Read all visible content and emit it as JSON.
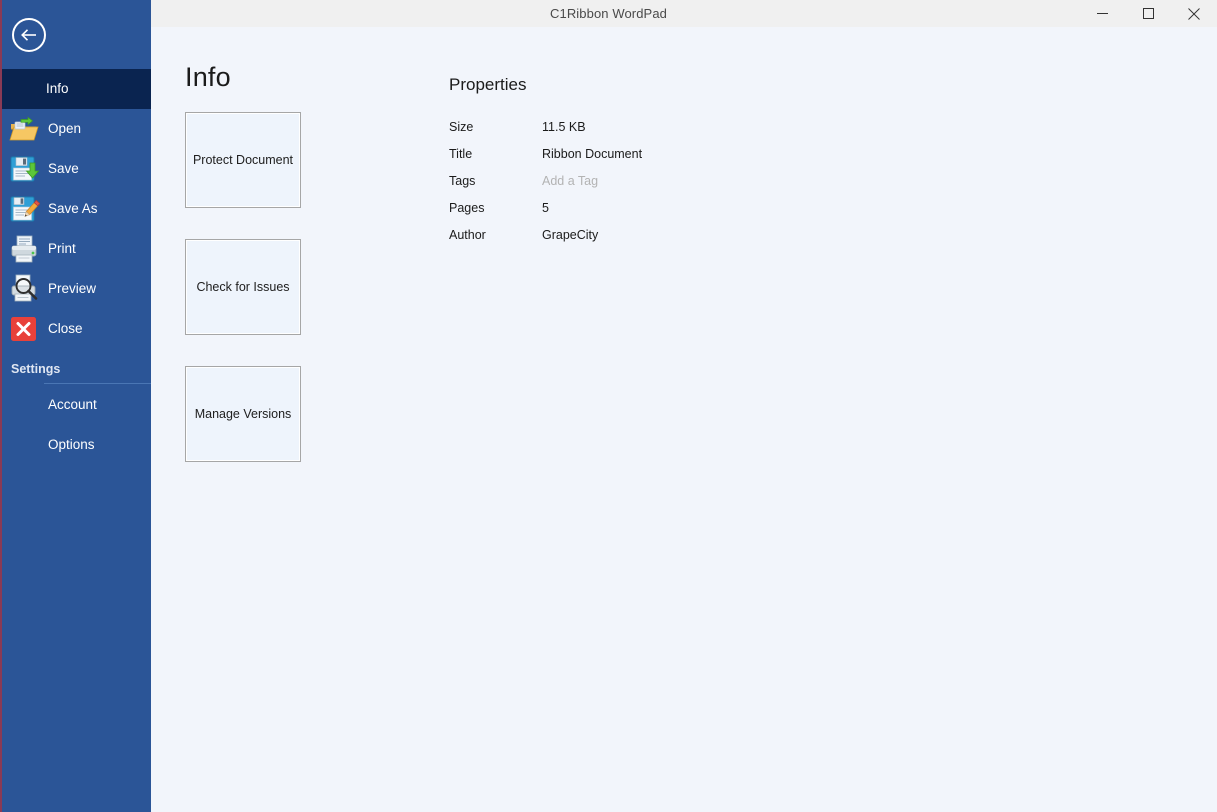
{
  "window": {
    "title": "C1Ribbon WordPad",
    "controls": [
      {
        "name": "minimize",
        "label": "Minimize"
      },
      {
        "name": "maximize",
        "label": "Maximize"
      },
      {
        "name": "close",
        "label": "Close"
      }
    ]
  },
  "backstage": {
    "back_label": "Back",
    "nav": [
      {
        "id": "info",
        "label": "Info",
        "icon": "none",
        "selected": true
      },
      {
        "id": "open",
        "label": "Open",
        "icon": "open-folder-icon",
        "selected": false
      },
      {
        "id": "save",
        "label": "Save",
        "icon": "save-disk-icon",
        "selected": false
      },
      {
        "id": "save-as",
        "label": "Save As",
        "icon": "save-as-disk-icon",
        "selected": false
      },
      {
        "id": "print",
        "label": "Print",
        "icon": "printer-icon",
        "selected": false
      },
      {
        "id": "preview",
        "label": "Preview",
        "icon": "print-preview-icon",
        "selected": false
      },
      {
        "id": "close",
        "label": "Close",
        "icon": "close-x-icon",
        "selected": false
      }
    ],
    "settings_header": "Settings",
    "settings_items": [
      {
        "id": "account",
        "label": "Account"
      },
      {
        "id": "options",
        "label": "Options"
      }
    ]
  },
  "main": {
    "page_title": "Info",
    "commands": [
      {
        "id": "protect-document",
        "label": "Protect Document"
      },
      {
        "id": "check-for-issues",
        "label": "Check for Issues"
      },
      {
        "id": "manage-versions",
        "label": "Manage Versions"
      }
    ],
    "properties": {
      "title": "Properties",
      "rows": [
        {
          "label": "Size",
          "value": "11.5 KB",
          "placeholder": false
        },
        {
          "label": "Title",
          "value": "Ribbon Document",
          "placeholder": false
        },
        {
          "label": "Tags",
          "value": "Add a Tag",
          "placeholder": true
        },
        {
          "label": "Pages",
          "value": "5",
          "placeholder": false
        },
        {
          "label": "Author",
          "value": "GrapeCity",
          "placeholder": false
        }
      ]
    }
  },
  "colors": {
    "sidebar": "#2b5597",
    "sidebar_selected": "#0a2450",
    "titlebar": "#f0f0f0",
    "content": "#f2f5fb",
    "button_fill": "#eef4fc",
    "button_border": "#a6a6a6",
    "accent_red": "#e8413a"
  }
}
